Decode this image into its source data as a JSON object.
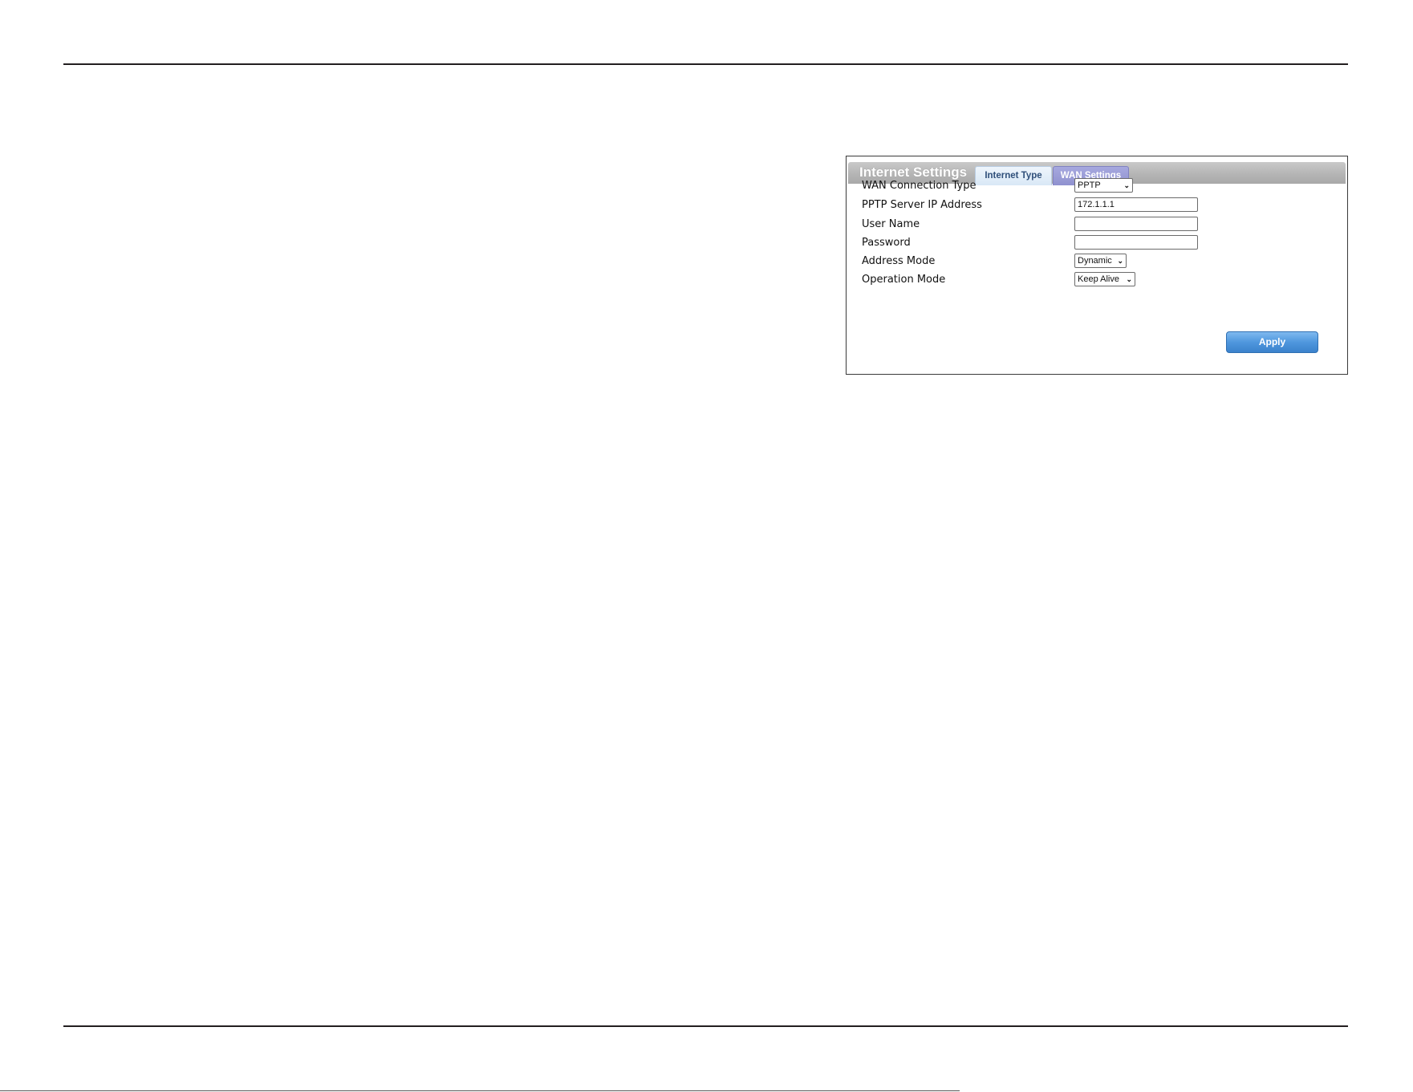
{
  "panel": {
    "title": "Internet Settings",
    "tabs": [
      {
        "label": "Internet Type",
        "active": false
      },
      {
        "label": "WAN Settings",
        "active": true
      }
    ]
  },
  "form": {
    "wan_connection_type": {
      "label": "WAN Connection Type",
      "value": "PPTP"
    },
    "pptp_server_ip": {
      "label": "PPTP Server IP Address",
      "value": "172.1.1.1"
    },
    "user_name": {
      "label": "User Name",
      "value": ""
    },
    "password": {
      "label": "Password",
      "value": ""
    },
    "address_mode": {
      "label": "Address Mode",
      "value": "Dynamic"
    },
    "operation_mode": {
      "label": "Operation Mode",
      "value": "Keep Alive"
    }
  },
  "apply_label": "Apply",
  "colors": {
    "tab_active": "#9a9cd6",
    "tab_inactive": "#e3eef9",
    "header": "#b5b5b5",
    "apply_button": "#4f97de"
  }
}
